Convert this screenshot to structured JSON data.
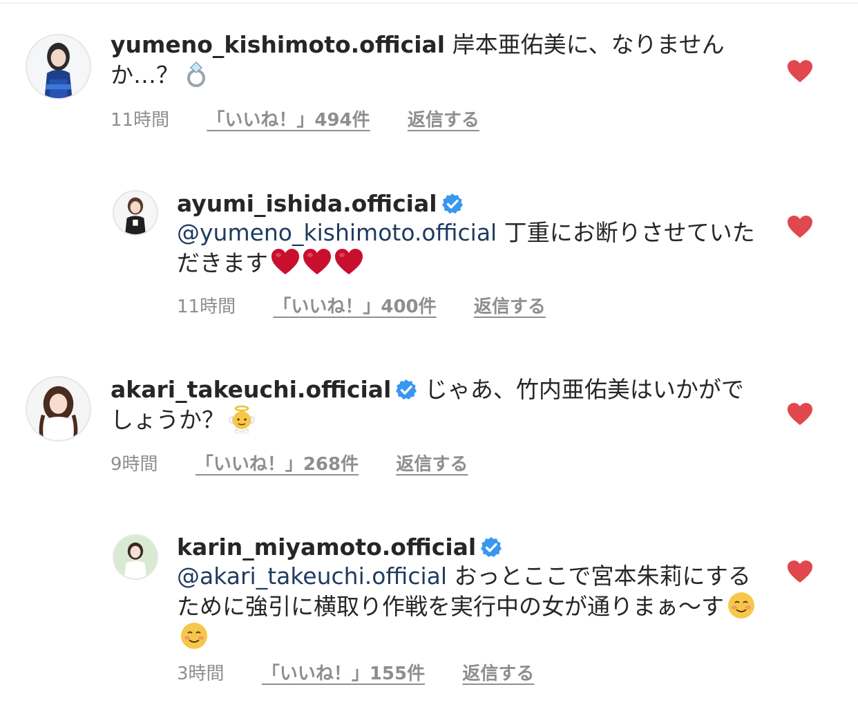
{
  "colors": {
    "heart": "#e0484d",
    "verified": "#3897f0",
    "mention": "#1e3a5f",
    "meta": "#8e8e8e"
  },
  "comments": [
    {
      "username": "yumeno_kishimoto.official",
      "verified": false,
      "text": "岸本亜佑美に、なりませんか…？",
      "emoji": [
        "ring-emoji"
      ],
      "time": "11時間",
      "likes": "「いいね！」494件",
      "reply": "返信する"
    },
    {
      "username": "ayumi_ishida.official",
      "verified": true,
      "mention": "@yumeno_kishimoto.official",
      "text": "丁重にお断りさせていただきます",
      "emoji": [
        "red-heart-emoji",
        "red-heart-emoji",
        "red-heart-emoji"
      ],
      "time": "11時間",
      "likes": "「いいね！」400件",
      "reply": "返信する"
    },
    {
      "username": "akari_takeuchi.official",
      "verified": true,
      "text": "じゃあ、竹内亜佑美はいかがでしょうか？",
      "emoji": [
        "angel-emoji"
      ],
      "time": "9時間",
      "likes": "「いいね！」268件",
      "reply": "返信する"
    },
    {
      "username": "karin_miyamoto.official",
      "verified": true,
      "mention": "@akari_takeuchi.official",
      "text": "おっとここで宮本朱莉にするために強引に横取り作戦を実行中の女が通りまぁ〜す",
      "emoji": [
        "smiling-face-emoji",
        "smiling-face-emoji"
      ],
      "time": "3時間",
      "likes": "「いいね！」155件",
      "reply": "返信する"
    }
  ]
}
